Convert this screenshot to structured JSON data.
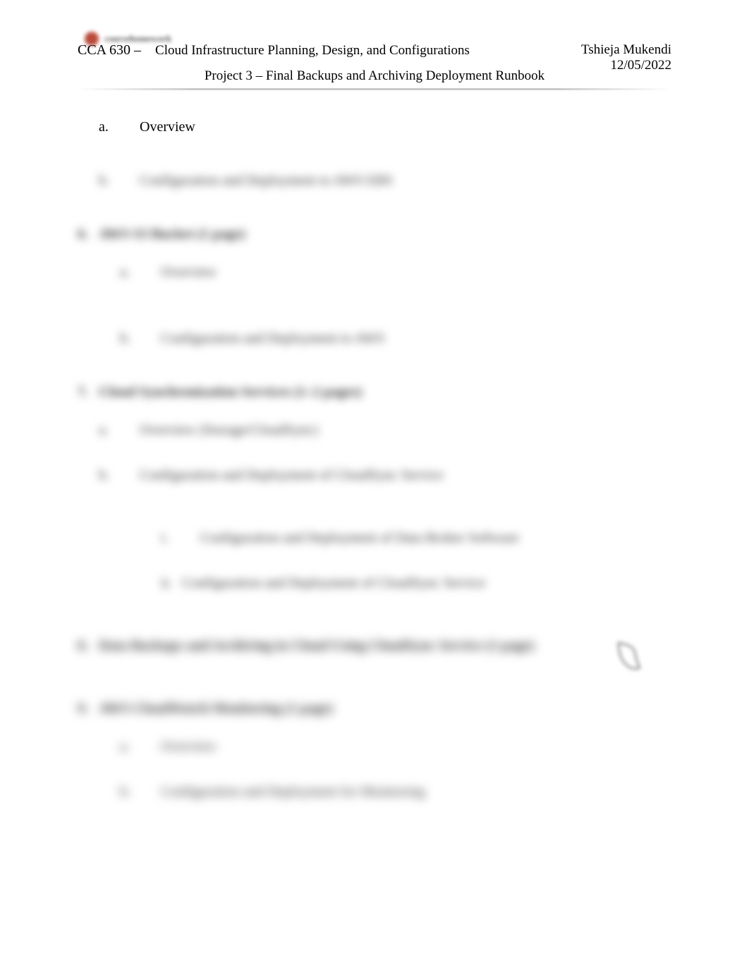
{
  "header": {
    "author": "Tshieja Mukendi",
    "date": "12/05/2022",
    "course_code": "CCA 630 –",
    "course_title": "Cloud Infrastructure Planning, Design, and Configurations",
    "project_title": "Project 3 – Final Backups and Archiving Deployment Runbook"
  },
  "watermark": {
    "brand": "coursehomework"
  },
  "outline": {
    "a_marker": "a.",
    "a_text": "Overview",
    "b_marker": "b.",
    "b_text": "Configuration and Deployment to AWS EBS",
    "sec6_marker": "6.",
    "sec6_text": "AWS S3 Bucket (1 page)",
    "sec6_a_marker": "a.",
    "sec6_a_text": "Overview",
    "sec6_b_marker": "b.",
    "sec6_b_text": "Configuration and Deployment to AWS",
    "sec7_marker": "7.",
    "sec7_text": "Cloud Synchronization Services (1–2 pages)",
    "sec7_a_marker": "a.",
    "sec7_a_text": "Overview (Storage/CloudSync)",
    "sec7_b_marker": "b.",
    "sec7_b_text": "Configuration and Deployment of CloudSync Service",
    "sec7_b_i_marker": "i.",
    "sec7_b_i_text": "Configuration and Deployment of Data Broker Software",
    "sec7_b_ii_marker": "ii.",
    "sec7_b_ii_text": "Configuration and Deployment of CloudSync Service",
    "sec8_marker": "8.",
    "sec8_text": "Data Backups and Archiving in Cloud Using CloudSync Service (1 page)",
    "sec9_marker": "9.",
    "sec9_text": "AWS CloudWatch Monitoring (1 page)",
    "sec9_a_marker": "a.",
    "sec9_a_text": "Overview",
    "sec9_b_marker": "b.",
    "sec9_b_text": "Configuration and Deployment for Monitoring"
  }
}
